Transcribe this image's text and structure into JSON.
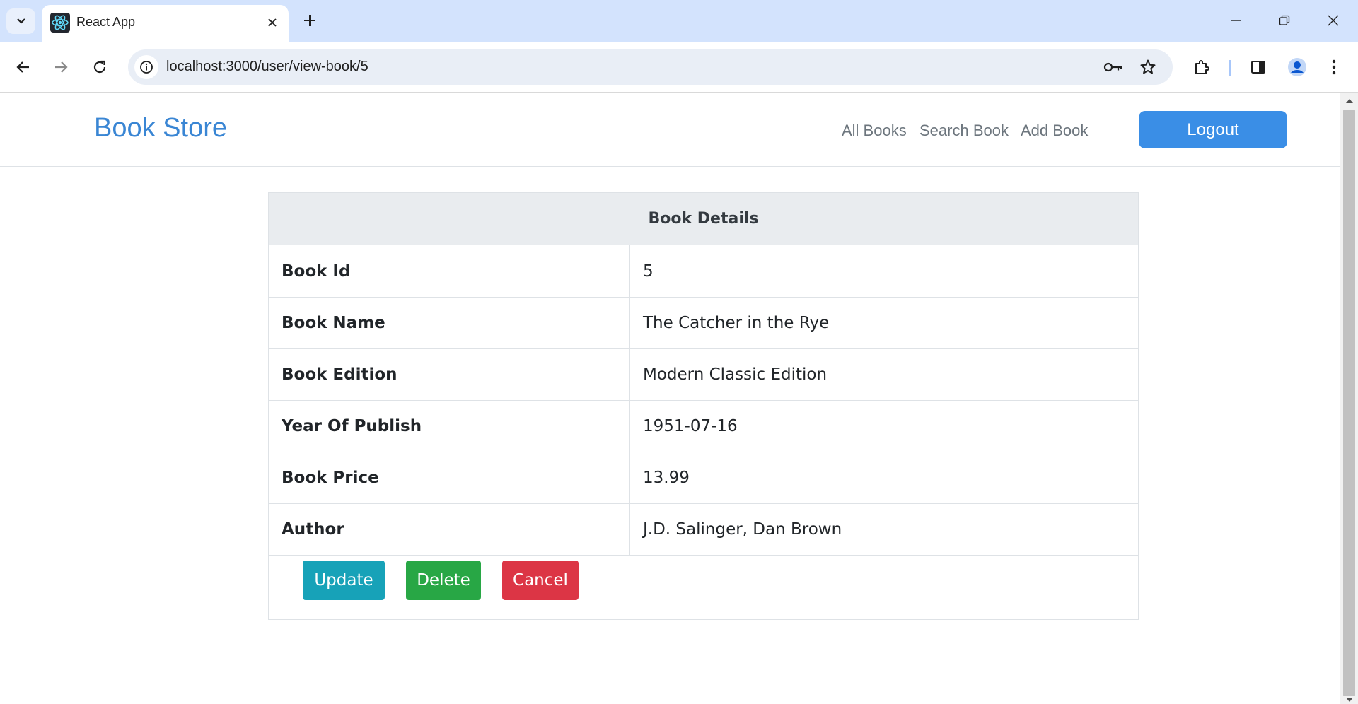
{
  "browser": {
    "tab_title": "React App",
    "url": "localhost:3000/user/view-book/5"
  },
  "navbar": {
    "brand": "Book Store",
    "links": [
      "All Books",
      "Search Book",
      "Add Book"
    ],
    "logout_label": "Logout"
  },
  "book_details": {
    "header": "Book Details",
    "rows": [
      {
        "label": "Book Id",
        "value": "5"
      },
      {
        "label": "Book Name",
        "value": "The Catcher in the Rye"
      },
      {
        "label": "Book Edition",
        "value": "Modern Classic Edition"
      },
      {
        "label": "Year Of Publish",
        "value": "1951-07-16"
      },
      {
        "label": "Book Price",
        "value": "13.99"
      },
      {
        "label": "Author",
        "value": "J.D. Salinger, Dan Brown"
      }
    ],
    "actions": {
      "update_label": "Update",
      "delete_label": "Delete",
      "cancel_label": "Cancel"
    }
  },
  "colors": {
    "brand": "#3a86d4",
    "logout": "#3a8ee6",
    "update": "#17a2b8",
    "delete": "#28a745",
    "cancel": "#dc3545"
  },
  "icons": [
    "tab-list-icon",
    "react-logo-icon",
    "close-icon",
    "plus-icon",
    "minimize-icon",
    "restore-icon",
    "window-close-icon",
    "back-arrow-icon",
    "forward-arrow-icon",
    "reload-icon",
    "site-info-icon",
    "key-icon",
    "star-icon",
    "extensions-icon",
    "side-panel-icon",
    "profile-icon",
    "kebab-menu-icon"
  ]
}
